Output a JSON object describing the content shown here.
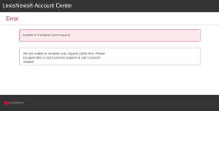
{
  "header": {
    "title": "LexisNexis® Account Center"
  },
  "page": {
    "title": "Error"
  },
  "error_alert": {
    "message": "Unable to Complete Your Request"
  },
  "message_box": {
    "text": "We are unable to complete your request at this time. Please try again later or call Customer Support at Call Customer Support"
  },
  "footer": {
    "logo_text": "LexisNexis"
  },
  "colors": {
    "header_bg": "#333333",
    "accent_red": "#c8102e",
    "alert_bg": "#fbe9ec",
    "alert_border": "#e8a6b1"
  }
}
